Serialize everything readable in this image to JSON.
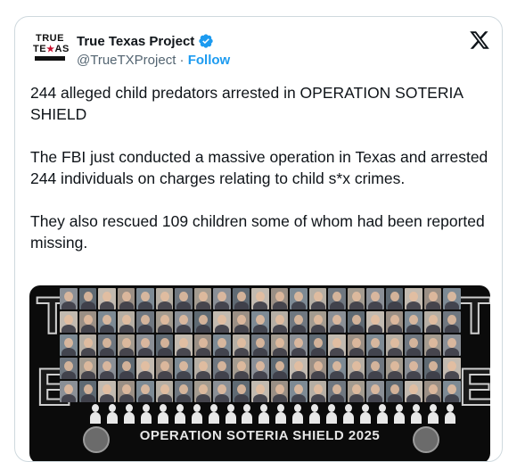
{
  "author": {
    "name": "True Texas Project",
    "handle": "@TrueTXProject",
    "separator": " · ",
    "follow_label": "Follow",
    "logo": {
      "line1": "TRUE",
      "line2a": "TE",
      "line2b": "AS",
      "star": "★"
    },
    "verified_icon": "verified-badge-icon",
    "verified_color": "#1d9bf0"
  },
  "close_icon": "x-logo-icon",
  "tweet": {
    "paragraphs": [
      "244 alleged child predators arrested in OPERATION SOTERIA SHIELD",
      "The FBI just conducted a massive operation in Texas and arrested 244 individuals on charges relating to child s*x crimes.",
      "They also rescued 109 children some of whom had been reported missing."
    ]
  },
  "media": {
    "banner_text": "OPERATION SOTERIA SHIELD 2025",
    "side_letter": "T",
    "side_letter_bottom": "E"
  }
}
